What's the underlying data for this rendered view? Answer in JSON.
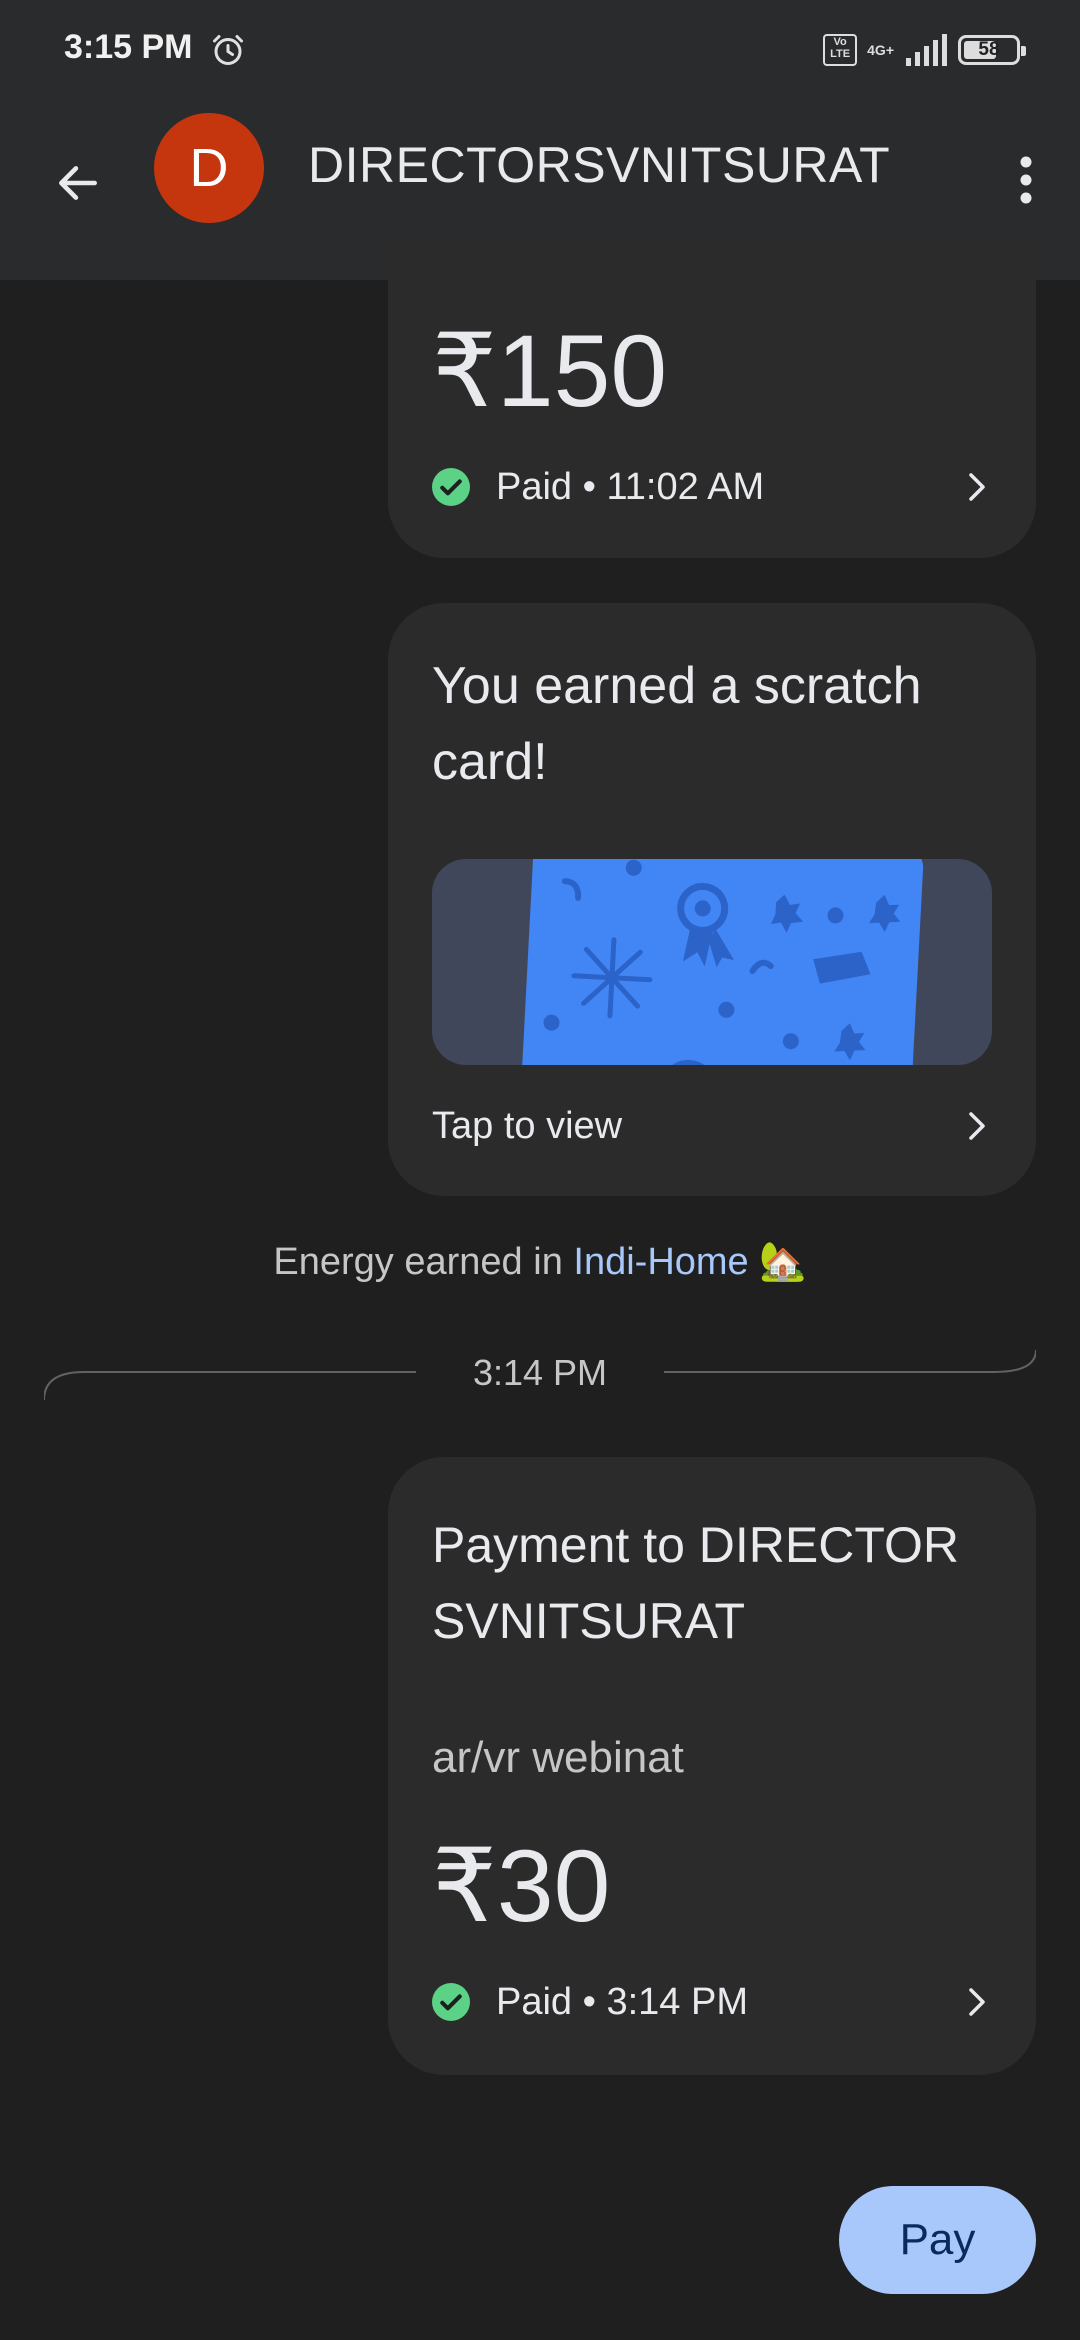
{
  "status_bar": {
    "time": "3:15 PM",
    "volte_label": "Vo LTE",
    "network_type": "4G+",
    "battery_level": "58",
    "icons": [
      "alarm-icon",
      "volte-icon",
      "signal-icon",
      "battery-icon"
    ]
  },
  "header": {
    "avatar_initial": "D",
    "avatar_color": "#c5360e",
    "title": "DIRECTORSVNITSURAT",
    "icons": [
      "back-arrow-icon",
      "more-vert-icon"
    ]
  },
  "messages": [
    {
      "type": "payment",
      "amount": "₹150",
      "status": "Paid • 11:02 AM"
    },
    {
      "type": "scratch_card",
      "title": "You earned a scratch card!",
      "action": "Tap to view"
    }
  ],
  "energy_note": {
    "prefix": "Energy earned in ",
    "link": "Indi-Home",
    "emoji": "🏡"
  },
  "timestamp_divider": "3:14 PM",
  "payment": {
    "title": "Payment to DIRECTORSVNITSURAT",
    "note": "ar/vr webinat",
    "amount": "₹30",
    "status": "Paid • 3:14 PM"
  },
  "pay_button": "Pay",
  "colors": {
    "background": "#1f1f1f",
    "card": "#2b2b2c",
    "accent": "#a8c7fa",
    "success": "#5bd285",
    "scratch_card_blue": "#4285f4"
  }
}
